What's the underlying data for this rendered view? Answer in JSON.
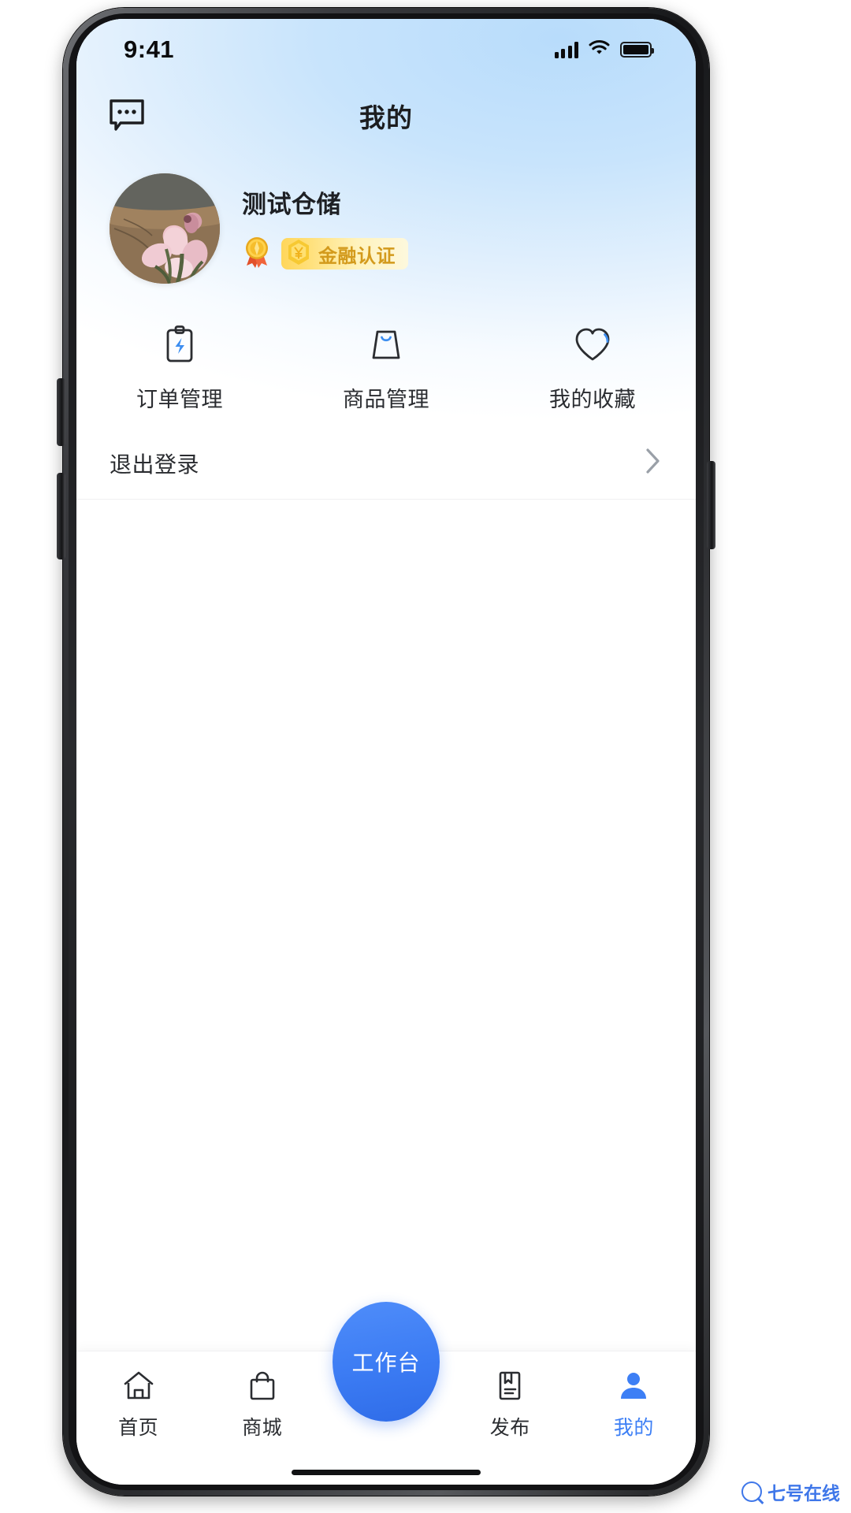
{
  "status_bar": {
    "time": "9:41",
    "signal_icon": "cellular-signal-icon",
    "wifi_icon": "wifi-icon",
    "battery_icon": "battery-full-icon"
  },
  "header": {
    "title": "我的",
    "message_icon": "message-bubble-icon"
  },
  "profile": {
    "name": "测试仓储",
    "avatar_alt": "avatar",
    "medal_icon": "gold-medal-icon",
    "certification": {
      "label": "金融认证",
      "icon": "yen-hexagon-icon",
      "text_color": "#d39a1c",
      "bg_start": "#ffd65a",
      "bg_end": "#fdf8dd"
    }
  },
  "quick_menu": [
    {
      "label": "订单管理",
      "icon": "clipboard-bolt-icon"
    },
    {
      "label": "商品管理",
      "icon": "shopping-bag-icon"
    },
    {
      "label": "我的收藏",
      "icon": "heart-icon"
    }
  ],
  "rows": [
    {
      "label": "退出登录",
      "chevron": "chevron-right-icon"
    }
  ],
  "fab": {
    "label": "工作台",
    "color": "#3b7bf3"
  },
  "tabbar": {
    "active_color": "#3d7ff5",
    "inactive_color": "#2a2c30",
    "items": [
      {
        "label": "首页",
        "icon": "home-icon",
        "active": false
      },
      {
        "label": "商城",
        "icon": "shopping-bag-icon",
        "active": false
      },
      {
        "label": "发布",
        "icon": "book-publish-icon",
        "active": false
      },
      {
        "label": "我的",
        "icon": "person-icon",
        "active": true
      }
    ]
  },
  "watermark": {
    "text": "七号在线",
    "icon": "search-circle-icon"
  }
}
